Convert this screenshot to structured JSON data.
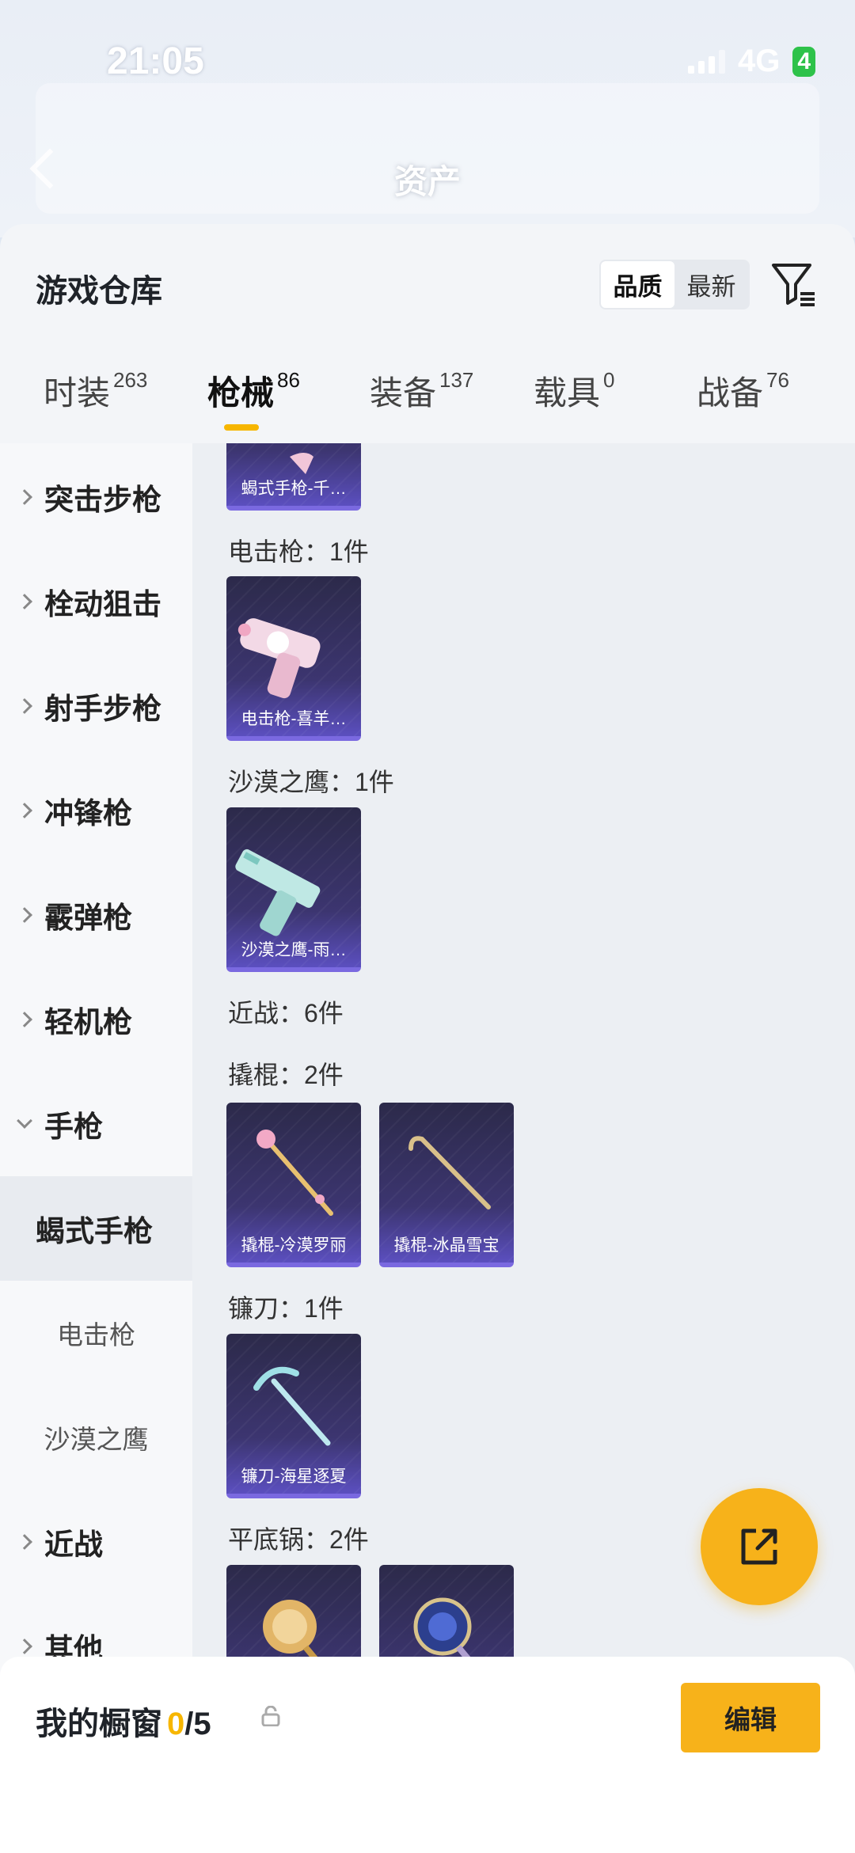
{
  "status": {
    "time": "21:05",
    "network": "4G",
    "battery": "4"
  },
  "header": {
    "title": "资产"
  },
  "sheet": {
    "title": "游戏仓库",
    "sort": [
      "品质",
      "最新"
    ],
    "sort_active": "品质"
  },
  "tabs": [
    {
      "label": "时装",
      "count": "263"
    },
    {
      "label": "枪械",
      "count": "86"
    },
    {
      "label": "装备",
      "count": "137"
    },
    {
      "label": "载具",
      "count": "0"
    },
    {
      "label": "战备",
      "count": "76"
    }
  ],
  "sidebar": [
    {
      "label": "突击步枪"
    },
    {
      "label": "栓动狙击"
    },
    {
      "label": "射手步枪"
    },
    {
      "label": "冲锋枪"
    },
    {
      "label": "霰弹枪"
    },
    {
      "label": "轻机枪"
    },
    {
      "label": "手枪"
    },
    {
      "label": "蝎式手枪"
    },
    {
      "label": "电击枪"
    },
    {
      "label": "沙漠之鹰"
    },
    {
      "label": "近战"
    },
    {
      "label": "其他"
    }
  ],
  "content": {
    "cards": [
      {
        "name": "蝎式手枪-千…"
      },
      {
        "name": "电击枪-喜羊…"
      },
      {
        "name": "沙漠之鹰-雨…"
      },
      {
        "name": "撬棍-冷漠罗丽"
      },
      {
        "name": "撬棍-冰晶雪宝"
      },
      {
        "name": "镰刀-海星逐夏"
      }
    ],
    "groups": [
      {
        "label": "电击枪：1件"
      },
      {
        "label": "沙漠之鹰：1件"
      },
      {
        "label": "近战：6件"
      },
      {
        "label": "撬棍：2件"
      },
      {
        "label": "镰刀：1件"
      },
      {
        "label": "平底锅：2件"
      }
    ]
  },
  "bottom": {
    "title": "我的橱窗",
    "current": "0",
    "total": "/5",
    "edit": "编辑"
  },
  "colors": {
    "accent": "#f7b600",
    "card_top": "#2c2a4a",
    "card_bottom": "#5b4fbf"
  }
}
